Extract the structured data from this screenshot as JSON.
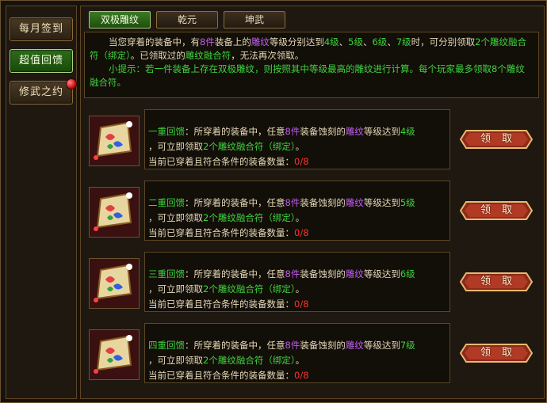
{
  "sidebar": {
    "items": [
      {
        "label": "每月签到"
      },
      {
        "label": "超值回馈"
      },
      {
        "label": "修武之约"
      }
    ]
  },
  "tabs": [
    {
      "label": "双极雕纹"
    },
    {
      "label": "乾元"
    },
    {
      "label": "坤武"
    }
  ],
  "info": {
    "p1_a": "当您穿着的装备中，有",
    "p1_b": "8件",
    "p1_c": "装备上的",
    "p1_d": "雕纹",
    "p1_e": "等级分别达到",
    "p1_f": "4级",
    "p1_g": "、",
    "p1_h": "5级",
    "p1_i": "、",
    "p1_j": "6级",
    "p1_k": "、",
    "p1_l": "7级",
    "p1_m": "时，可分别领取",
    "p1_n": "2个雕纹融合符（绑定）",
    "p1_o": "。已领取过的",
    "p1_p": "雕纹融合符",
    "p1_q": "，无法再次领取。",
    "p2_a": "小提示：若一件装备上存在双极雕纹，则按照其中等级最高的雕纹进行计算。每个玩家最多领取",
    "p2_b": "8个雕纹融合符",
    "p2_c": "。"
  },
  "rewards": [
    {
      "title": "一重回馈",
      "level": "4级",
      "progress": "0/8"
    },
    {
      "title": "二重回馈",
      "level": "5级",
      "progress": "0/8"
    },
    {
      "title": "三重回馈",
      "level": "6级",
      "progress": "0/8"
    },
    {
      "title": "四重回馈",
      "level": "7级",
      "progress": "0/8"
    }
  ],
  "reward_text": {
    "colon": "：所穿着的装备中，任意",
    "count": "8件",
    "mid": "装备蚀刻的",
    "diaowen": "雕纹",
    "reach": "等级达到",
    "line2_a": "，可立即领取",
    "line2_b": "2个雕纹融合符（绑定）",
    "line2_c": "。",
    "line3": "当前已穿着且符合条件的装备数量："
  },
  "claim_label": "领取",
  "icons": {
    "reward_icon": "scroll-icon",
    "notify": "red-dot-icon"
  },
  "colors": {
    "green": "#3ed43e",
    "purple": "#c05cf0",
    "red": "#ff3030",
    "gold": "#e6d8b8"
  }
}
